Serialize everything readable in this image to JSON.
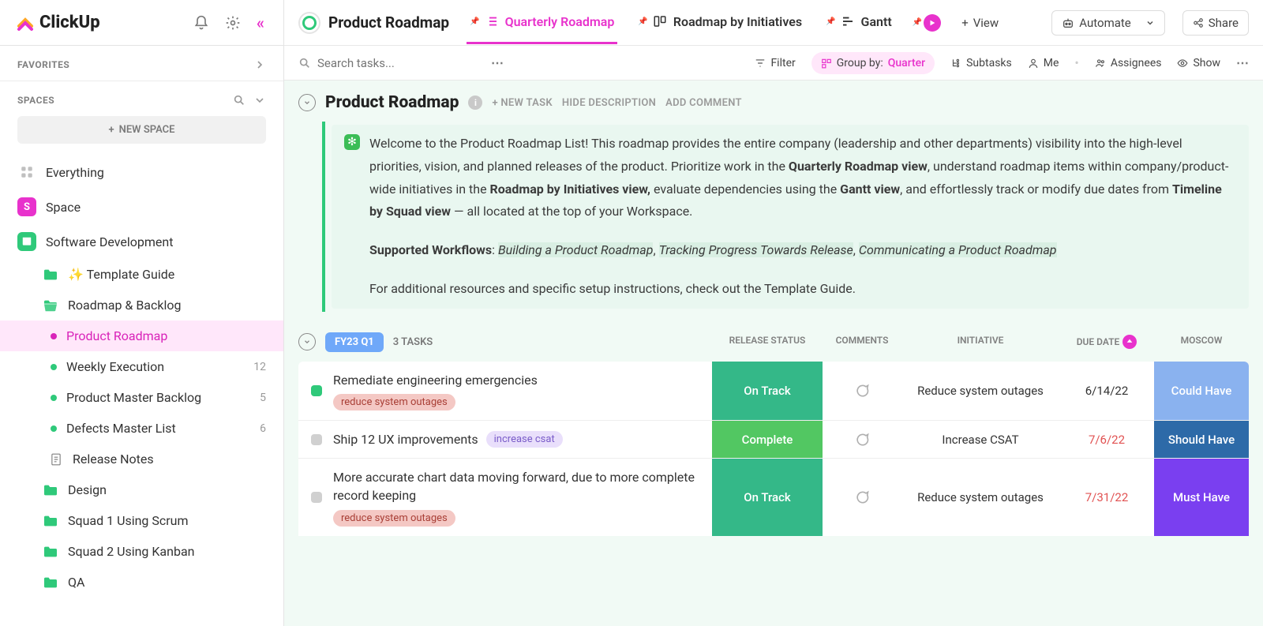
{
  "app": {
    "name": "ClickUp"
  },
  "sidebar": {
    "favorites_label": "FAVORITES",
    "spaces_label": "SPACES",
    "new_space": "NEW SPACE",
    "items": [
      {
        "label": "Everything"
      },
      {
        "label": "Space"
      },
      {
        "label": "Software Development"
      }
    ],
    "tree": [
      {
        "label": "✨ Template Guide",
        "type": "folder"
      },
      {
        "label": "Roadmap & Backlog",
        "type": "folder",
        "expanded": true
      },
      {
        "label": "Product Roadmap",
        "type": "list",
        "active": true
      },
      {
        "label": "Weekly Execution",
        "type": "list",
        "count": "12"
      },
      {
        "label": "Product Master Backlog",
        "type": "list",
        "count": "5"
      },
      {
        "label": "Defects Master List",
        "type": "list",
        "count": "6"
      },
      {
        "label": "Release Notes",
        "type": "doc"
      },
      {
        "label": "Design",
        "type": "folder"
      },
      {
        "label": "Squad 1 Using Scrum",
        "type": "folder"
      },
      {
        "label": "Squad 2 Using Kanban",
        "type": "folder"
      },
      {
        "label": "QA",
        "type": "folder"
      }
    ]
  },
  "tabs": {
    "folder_title": "Product Roadmap",
    "views": [
      {
        "label": "Quarterly Roadmap",
        "active": true
      },
      {
        "label": "Roadmap by Initiatives"
      },
      {
        "label": "Gantt"
      }
    ],
    "add_view": "View",
    "automate": "Automate",
    "share": "Share"
  },
  "toolbar": {
    "search_placeholder": "Search tasks...",
    "filter": "Filter",
    "group_by_label": "Group by:",
    "group_by_value": "Quarter",
    "subtasks": "Subtasks",
    "me": "Me",
    "assignees": "Assignees",
    "show": "Show"
  },
  "list_header": {
    "title": "Product Roadmap",
    "new_task": "+ NEW TASK",
    "hide_desc": "HIDE DESCRIPTION",
    "add_comment": "ADD COMMENT"
  },
  "description": {
    "p1a": "Welcome to the Product Roadmap List! This roadmap provides the entire company (leadership and other departments) visibility into the high-level priorities, vision, and planned releases of the product. Prioritize work in the ",
    "p1b": "Quarterly Roadmap view",
    "p1c": ", understand roadmap items within company/product-wide initiatives in the ",
    "p1d": "Roadmap by Initiatives view,",
    "p1e": " evaluate dependencies using the ",
    "p1f": "Gantt view",
    "p1g": ", and effortlessly track or modify due dates from ",
    "p1h": "Timeline by Squad view",
    "p1i": " — all located at the top of your Workspace.",
    "p2a": "Supported Workflows",
    "p2b": ": ",
    "w1": "Building a Product Roadmap",
    "w2": "Tracking Progress Towards Release",
    "w3": "Communicating a Product Roadmap",
    "p3": "For additional resources and specific setup instructions, check out the Template Guide."
  },
  "group": {
    "quarter": "FY23 Q1",
    "count": "3 TASKS",
    "columns": {
      "release": "RELEASE STATUS",
      "comments": "COMMENTS",
      "initiative": "INITIATIVE",
      "due": "DUE DATE",
      "moscow": "MOSCOW"
    }
  },
  "tasks": [
    {
      "name": "Remediate engineering emergencies",
      "tags": [
        {
          "text": "reduce system outages",
          "cls": "red"
        }
      ],
      "status_color": "#2fc97a",
      "release": "On Track",
      "release_bg": "#34b888",
      "initiative": "Reduce system outages",
      "due": "6/14/22",
      "due_color": "#333",
      "moscow": "Could Have",
      "moscow_bg": "#8ab2ef"
    },
    {
      "name": "Ship 12 UX improvements",
      "tags": [
        {
          "text": "increase csat",
          "cls": "purple"
        }
      ],
      "inline_tag": true,
      "status_color": "#d0d0d0",
      "release": "Complete",
      "release_bg": "#52c762",
      "initiative": "Increase CSAT",
      "due": "7/6/22",
      "due_color": "#e15252",
      "moscow": "Should Have",
      "moscow_bg": "#2d6aa8"
    },
    {
      "name": "More accurate chart data moving forward, due to more complete record keeping",
      "tags": [
        {
          "text": "reduce system outages",
          "cls": "red"
        }
      ],
      "status_color": "#d0d0d0",
      "release": "On Track",
      "release_bg": "#34b888",
      "initiative": "Reduce system outages",
      "due": "7/31/22",
      "due_color": "#e15252",
      "moscow": "Must Have",
      "moscow_bg": "#7a3ff0"
    }
  ]
}
